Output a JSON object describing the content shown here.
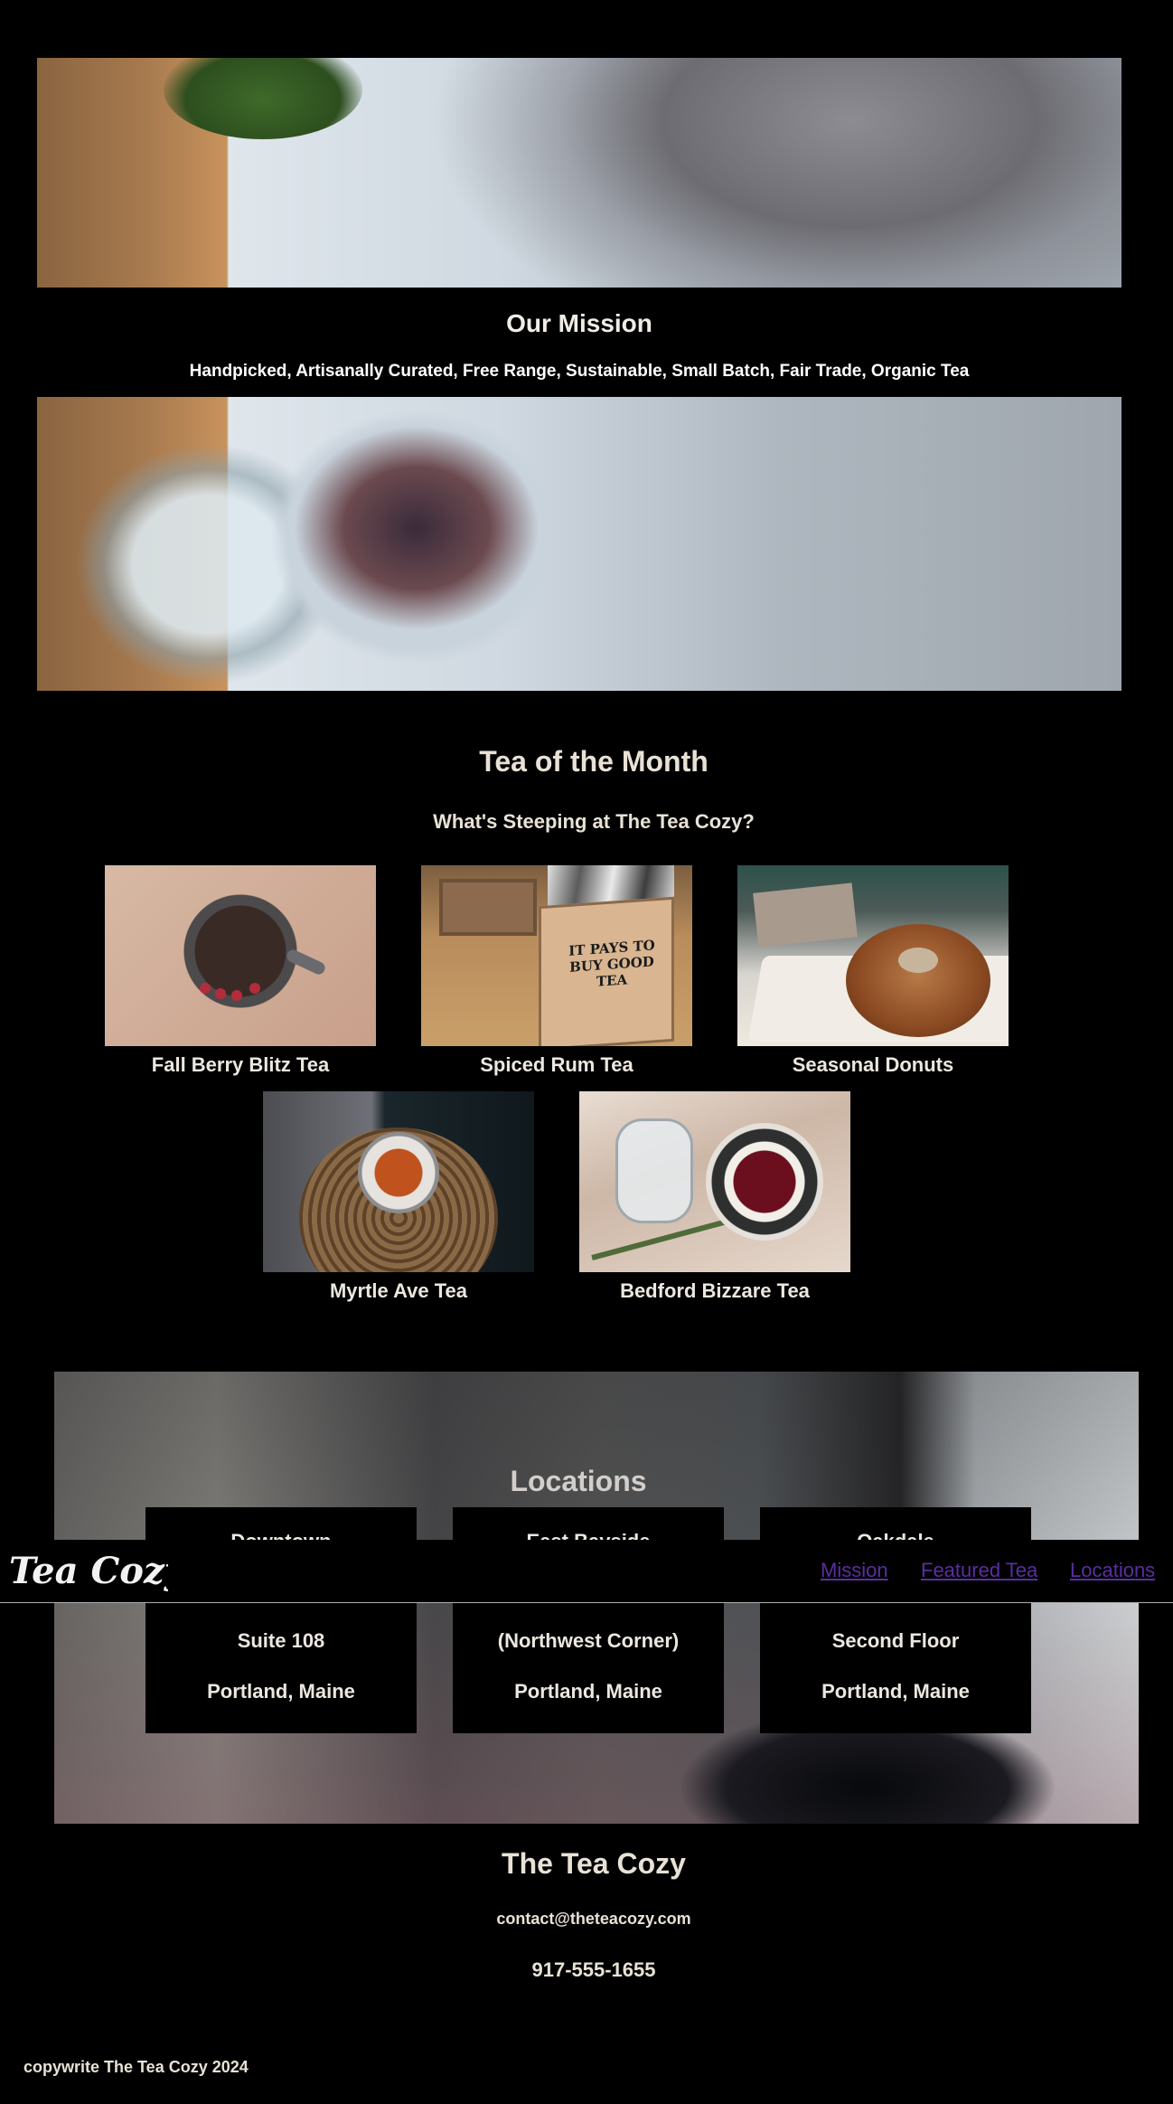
{
  "header": {
    "brand": "Tea Cozy",
    "nav": [
      {
        "label": "Mission"
      },
      {
        "label": "Featured Tea"
      },
      {
        "label": "Locations"
      }
    ],
    "nav_link_color": "#5a2fa0"
  },
  "mission": {
    "title": "Our Mission",
    "subtitle": "Handpicked, Artisanally Curated, Free Range, Sustainable, Small Batch, Fair Trade, Organic Tea"
  },
  "tea_of_month": {
    "title": "Tea of the Month",
    "subtitle": "What's Steeping at The Tea Cozy?",
    "items": [
      {
        "name": "Fall Berry Blitz Tea"
      },
      {
        "name": "Spiced Rum Tea"
      },
      {
        "name": "Seasonal Donuts"
      },
      {
        "name": "Myrtle Ave Tea"
      },
      {
        "name": "Bedford Bizzare Tea"
      }
    ],
    "box_label": "IT PAYS TO BUY GOOD TEA"
  },
  "locations": {
    "title": "Locations",
    "stores": [
      {
        "name": "Downtown",
        "line2": "Suite 108",
        "line3": "Portland, Maine"
      },
      {
        "name": "East Bayside",
        "line2": "(Northwest Corner)",
        "line3": "Portland, Maine"
      },
      {
        "name": "Oakdale",
        "line2": "Second Floor",
        "line3": "Portland, Maine"
      }
    ]
  },
  "footer": {
    "title": "The Tea Cozy",
    "email": "contact@theteacozy.com",
    "phone": "917-555-1655",
    "copyright": "copywrite The Tea Cozy 2024"
  }
}
